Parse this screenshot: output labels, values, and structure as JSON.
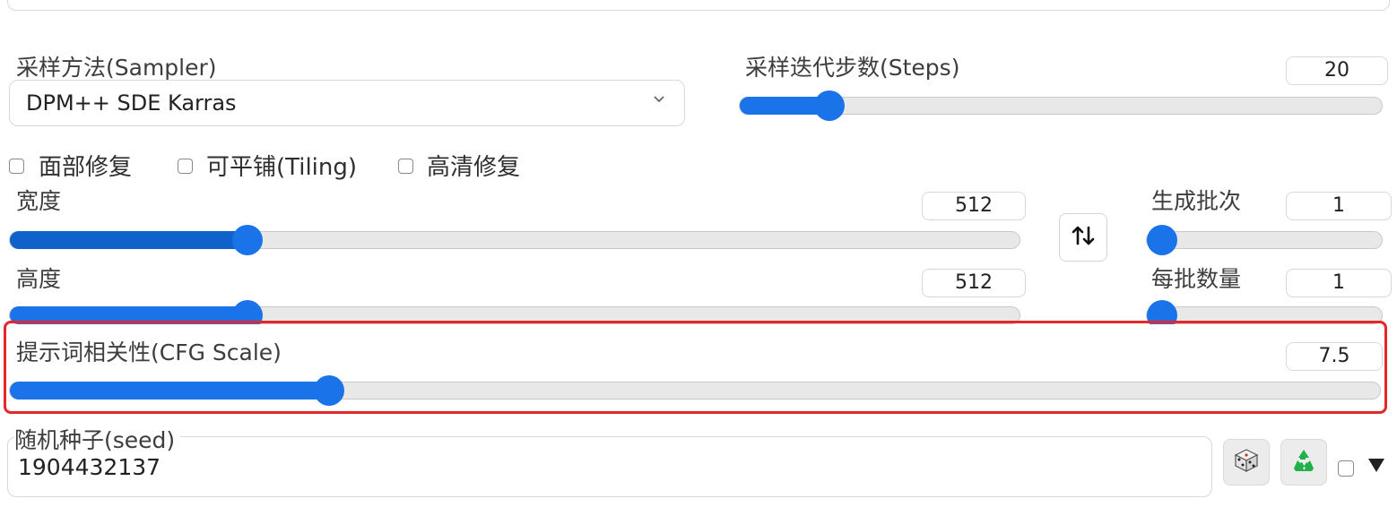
{
  "sampler": {
    "label": "采样方法(Sampler)",
    "value": "DPM++ SDE Karras"
  },
  "steps": {
    "label": "采样迭代步数(Steps)",
    "value": "20",
    "fraction": 0.14
  },
  "checkboxes": [
    {
      "label": "面部修复",
      "checked": false
    },
    {
      "label": "可平铺(Tiling)",
      "checked": false
    },
    {
      "label": "高清修复",
      "checked": false
    }
  ],
  "width": {
    "label": "宽度",
    "value": "512",
    "fraction": 0.235
  },
  "height": {
    "label": "高度",
    "value": "512",
    "fraction": 0.235
  },
  "batch_count": {
    "label": "生成批次",
    "value": "1",
    "fraction": 0.0
  },
  "batch_size": {
    "label": "每批数量",
    "value": "1",
    "fraction": 0.0
  },
  "cfg": {
    "label": "提示词相关性(CFG Scale)",
    "value": "7.5",
    "fraction": 0.233
  },
  "seed": {
    "label": "随机种子(seed)",
    "value": "1904432137"
  },
  "colors": {
    "accent": "#1a73e8",
    "highlight_border": "#e5262a",
    "recycle": "#20b14a"
  },
  "icons": {
    "swap": "swap-arrows-icon",
    "dice": "dice-icon",
    "recycle": "recycle-icon",
    "expand": "triangle-down-icon",
    "dropdown": "chevron-down-icon"
  }
}
